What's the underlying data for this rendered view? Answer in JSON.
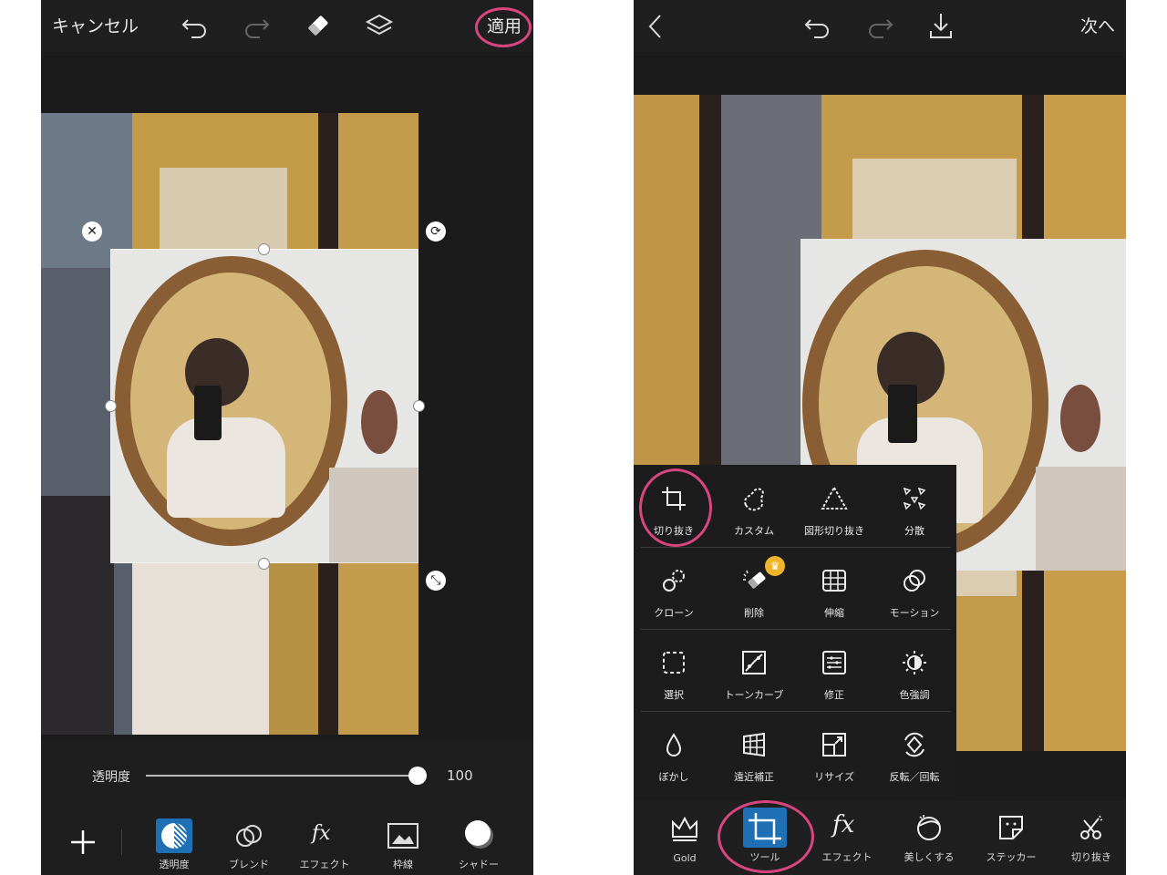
{
  "left": {
    "topbar": {
      "cancel_label": "キャンセル",
      "apply_label": "適用"
    },
    "opacity": {
      "label": "透明度",
      "value": "100",
      "level": 1.0
    },
    "tabs": [
      {
        "icon": "opacity-icon",
        "label": "透明度"
      },
      {
        "icon": "blend-icon",
        "label": "ブレンド"
      },
      {
        "icon": "fx-icon",
        "label": "エフェクト"
      },
      {
        "icon": "border-icon",
        "label": "枠線"
      },
      {
        "icon": "shadow-icon",
        "label": "シャドー"
      }
    ]
  },
  "right": {
    "topbar": {
      "next_label": "次へ"
    },
    "tools_menu": [
      {
        "icon": "crop-icon",
        "label": "切り抜き"
      },
      {
        "icon": "custom-shape-icon",
        "label": "カスタム"
      },
      {
        "icon": "shape-crop-icon",
        "label": "図形切り抜き"
      },
      {
        "icon": "disperse-icon",
        "label": "分散"
      },
      {
        "icon": "clone-icon",
        "label": "クローン"
      },
      {
        "icon": "remove-icon",
        "label": "削除"
      },
      {
        "icon": "stretch-icon",
        "label": "伸縮"
      },
      {
        "icon": "motion-icon",
        "label": "モーション"
      },
      {
        "icon": "select-icon",
        "label": "選択"
      },
      {
        "icon": "tone-curve-icon",
        "label": "トーンカーブ"
      },
      {
        "icon": "adjust-icon",
        "label": "修正"
      },
      {
        "icon": "color-enhance-icon",
        "label": "色強調"
      },
      {
        "icon": "blur-icon",
        "label": "ぼかし"
      },
      {
        "icon": "perspective-icon",
        "label": "遠近補正"
      },
      {
        "icon": "resize-icon",
        "label": "リサイズ"
      },
      {
        "icon": "flip-rotate-icon",
        "label": "反転／回転"
      }
    ],
    "bottom_tabs": [
      {
        "icon": "crown-icon",
        "label": "Gold"
      },
      {
        "icon": "tools-crop-icon",
        "label": "ツール"
      },
      {
        "icon": "fx-icon",
        "label": "エフェクト"
      },
      {
        "icon": "beautify-icon",
        "label": "美しくする"
      },
      {
        "icon": "sticker-icon",
        "label": "ステッカー"
      },
      {
        "icon": "cutout-icon",
        "label": "切り抜き"
      }
    ]
  },
  "colors": {
    "accent_pink": "#d9457e",
    "selected_blue": "#1e6fb4",
    "gold_crown": "#f0b429"
  }
}
